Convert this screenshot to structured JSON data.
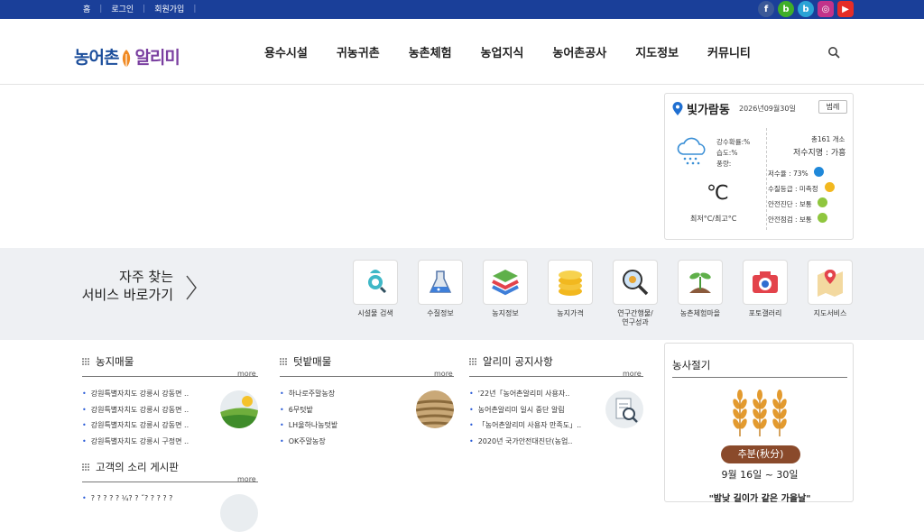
{
  "topbar": {
    "links": [
      "홈",
      "로그인",
      "회원가입"
    ],
    "social": [
      {
        "name": "facebook-icon",
        "glyph": "f",
        "color": "#3b5998"
      },
      {
        "name": "band-icon",
        "glyph": "b",
        "color": "#3fae2a"
      },
      {
        "name": "blog-icon",
        "glyph": "b",
        "color": "#2aa3d6"
      },
      {
        "name": "instagram-icon",
        "glyph": "◎",
        "color": "#c2338a"
      },
      {
        "name": "youtube-icon",
        "glyph": "▶",
        "color": "#e52d27"
      }
    ]
  },
  "header": {
    "logo_part1": "농어촌",
    "logo_part2": "알리미",
    "nav": [
      "용수시설",
      "귀농귀촌",
      "농촌체험",
      "농업지식",
      "농어촌공사",
      "지도정보",
      "커뮤니티"
    ]
  },
  "weather": {
    "location": "빛가람동",
    "date": "2026년09월30일",
    "button": "범례",
    "precip": "강수확률:%",
    "humidity": "습도:%",
    "rain": "풍량:",
    "temp": "℃",
    "minmax": "최저°C/최고°C",
    "total": "총161 개소",
    "reservoir": "저수지명 : 가흥",
    "rate": "저수율 : 73%",
    "quality": "수질등급 : 미측정",
    "safety_diag": "안전진단 : 보통",
    "safety_check": "안전점검 : 보통"
  },
  "services": {
    "title_line1": "자주 찾는",
    "title_line2": "서비스 바로가기",
    "items": [
      {
        "label": "시설물 검색",
        "icon": "facility-search-icon"
      },
      {
        "label": "수질정보",
        "icon": "water-quality-icon"
      },
      {
        "label": "농지정보",
        "icon": "farmland-info-icon"
      },
      {
        "label": "농지가격",
        "icon": "farmland-price-icon"
      },
      {
        "label": "연구간행물/\n연구성과",
        "icon": "research-icon"
      },
      {
        "label": "농촌체험마을",
        "icon": "rural-experience-icon"
      },
      {
        "label": "포토갤러리",
        "icon": "photo-gallery-icon"
      },
      {
        "label": "지도서비스",
        "icon": "map-service-icon"
      }
    ]
  },
  "panels": {
    "farmland": {
      "title": "농지매물",
      "more": "more",
      "items": [
        "강원특별자치도 강릉시 강동면 ..",
        "강원특별자치도 강릉시 강동면 ..",
        "강원특별자치도 강릉시 강동면 ..",
        "강원특별자치도 강릉시 구정면 .."
      ]
    },
    "garden": {
      "title": "텃밭매물",
      "more": "more",
      "items": [
        "하나로주말농장",
        "6무텃밭",
        "LH울하나농텃밭",
        "OK주말농장"
      ]
    },
    "notice": {
      "title": "알리미 공지사항",
      "more": "more",
      "items": [
        "'22년「농어촌알리미 사용자..",
        "농어촌알리미 일시 중단 알림",
        "「농어촌알리미 사용자 만족도」..",
        "2020년 국가안전대진단(농업.."
      ]
    },
    "voice": {
      "title": "고객의 소리 게시판",
      "more": "more",
      "items": [
        "? ? ? ? ? ¼? ? ˝? ? ?   ? ?"
      ]
    }
  },
  "season": {
    "title": "농사절기",
    "name": "추분(秋分)",
    "period": "9월 16일 ~ 30일",
    "desc": "\"밤낮 길이가 같은 가을날\""
  }
}
